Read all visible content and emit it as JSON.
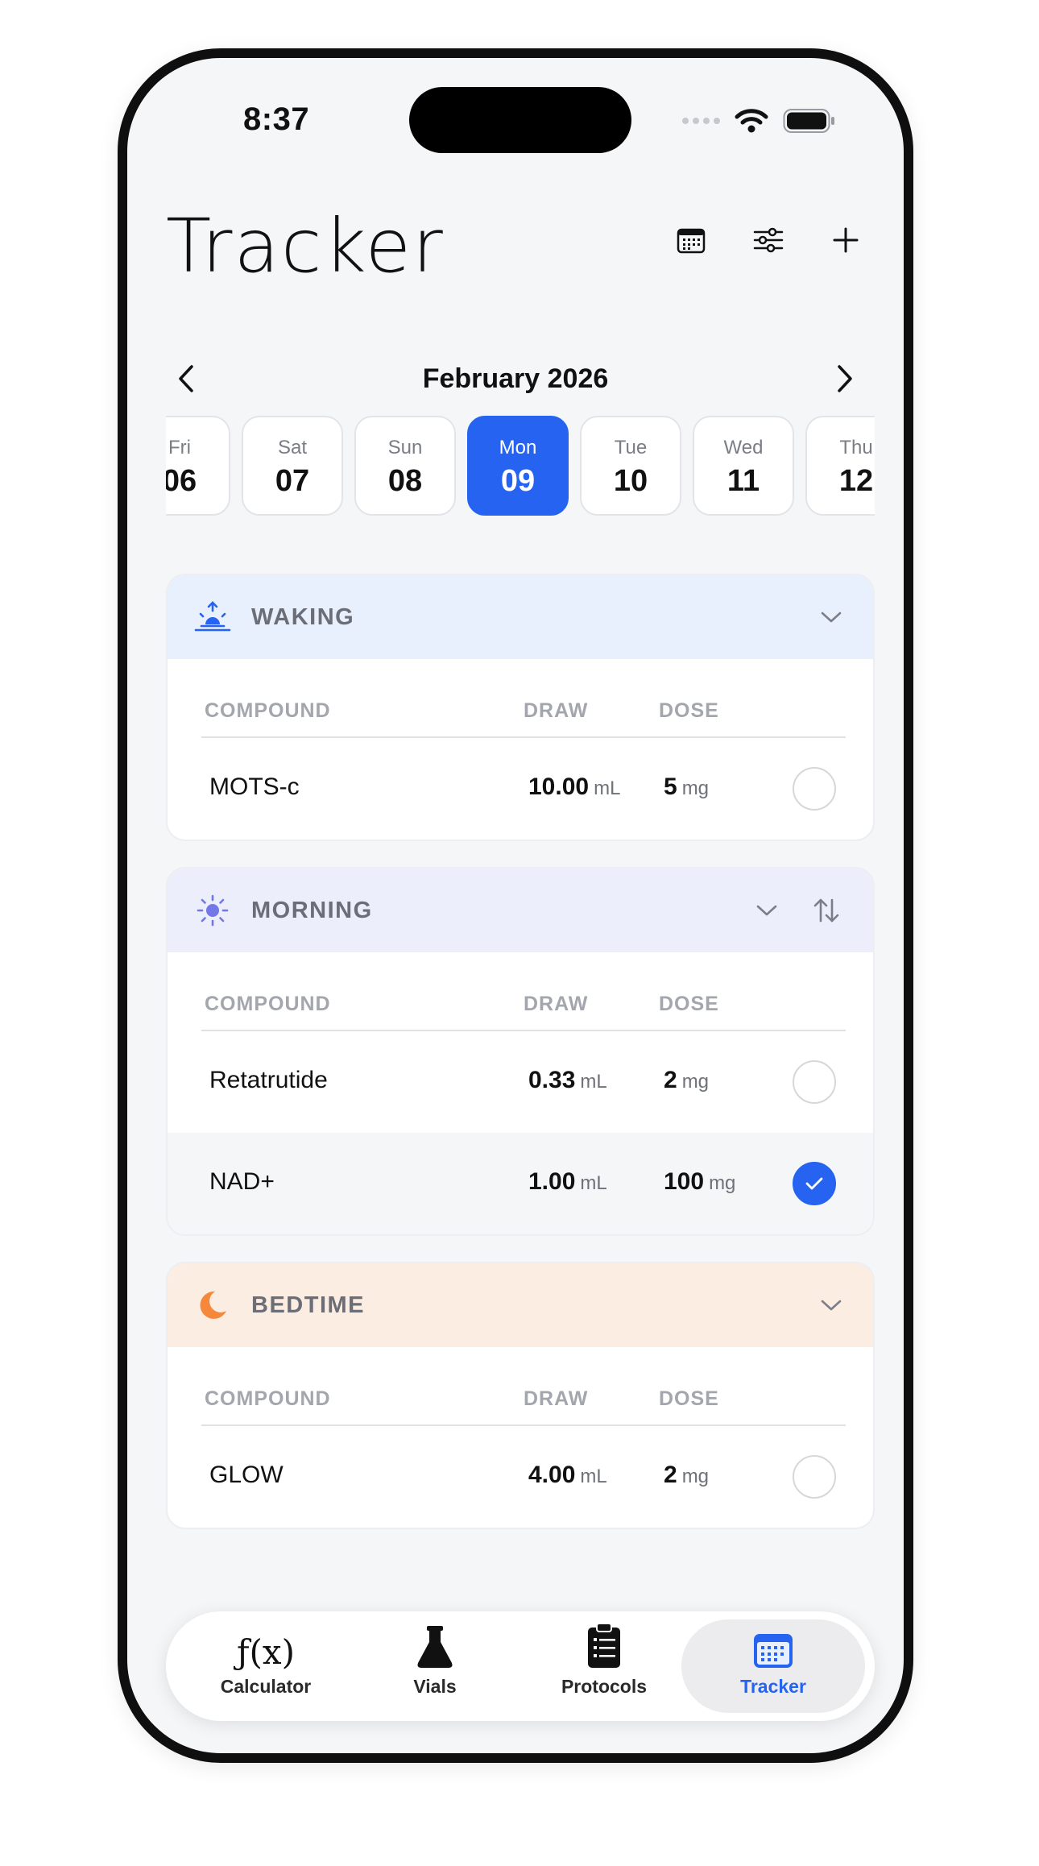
{
  "status_bar": {
    "time": "8:37"
  },
  "header": {
    "title": "Tracker"
  },
  "month_nav": {
    "label": "February 2026"
  },
  "days": [
    {
      "name": "Fri",
      "num": "06"
    },
    {
      "name": "Sat",
      "num": "07"
    },
    {
      "name": "Sun",
      "num": "08"
    },
    {
      "name": "Mon",
      "num": "09",
      "selected": true
    },
    {
      "name": "Tue",
      "num": "10"
    },
    {
      "name": "Wed",
      "num": "11"
    },
    {
      "name": "Thu",
      "num": "12"
    }
  ],
  "table_headers": {
    "compound": "COMPOUND",
    "draw": "DRAW",
    "dose": "DOSE"
  },
  "periods": {
    "waking": {
      "title": "WAKING",
      "rows": [
        {
          "compound": "MOTS-c",
          "draw": "10.00",
          "draw_unit": "mL",
          "dose": "5",
          "dose_unit": "mg",
          "taken": false
        }
      ]
    },
    "morning": {
      "title": "MORNING",
      "rows": [
        {
          "compound": "Retatrutide",
          "draw": "0.33",
          "draw_unit": "mL",
          "dose": "2",
          "dose_unit": "mg",
          "taken": false
        },
        {
          "compound": "NAD+",
          "draw": "1.00",
          "draw_unit": "mL",
          "dose": "100",
          "dose_unit": "mg",
          "taken": true
        }
      ]
    },
    "bedtime": {
      "title": "BEDTIME",
      "rows": [
        {
          "compound": "GLOW",
          "draw": "4.00",
          "draw_unit": "mL",
          "dose": "2",
          "dose_unit": "mg",
          "taken": false
        }
      ]
    }
  },
  "tab_bar": {
    "items": [
      {
        "label": "Calculator",
        "icon": "function-icon"
      },
      {
        "label": "Vials",
        "icon": "flask-icon"
      },
      {
        "label": "Protocols",
        "icon": "clipboard-icon"
      },
      {
        "label": "Tracker",
        "icon": "calendar-icon",
        "active": true
      }
    ]
  },
  "colors": {
    "accent": "#2563f0",
    "waking_header": "#e8effd",
    "morning_header": "#eceefc",
    "bedtime_header": "#fcede3",
    "bedtime_icon": "#f5883a",
    "morning_icon": "#7378e6"
  }
}
